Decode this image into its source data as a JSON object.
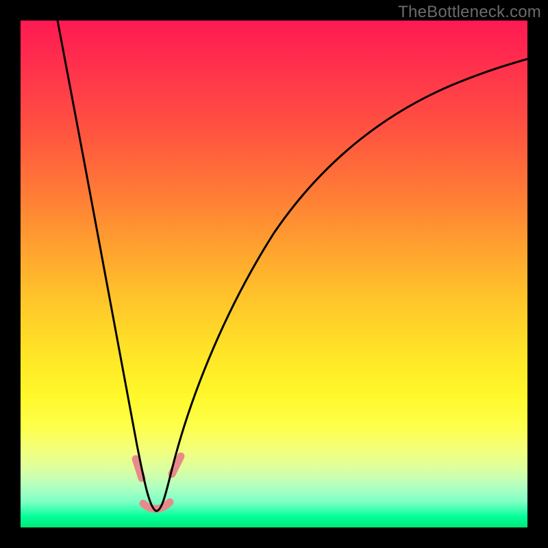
{
  "watermark": "TheBottleneck.com",
  "chart_data": {
    "type": "line",
    "title": "",
    "xlabel": "",
    "ylabel": "",
    "xlim": [
      0,
      100
    ],
    "ylim": [
      0,
      100
    ],
    "grid": false,
    "legend": false,
    "series": [
      {
        "name": "bottleneck-curve",
        "x": [
          7,
          11,
          15,
          18,
          20,
          22,
          24,
          25,
          26,
          27,
          28,
          29,
          30,
          33,
          37,
          42,
          48,
          55,
          63,
          72,
          82,
          92,
          100
        ],
        "y": [
          100,
          80,
          60,
          42,
          30,
          18,
          8,
          3,
          2.5,
          2.5,
          3,
          4,
          6,
          14,
          25,
          37,
          49,
          60,
          69,
          77,
          82,
          86,
          88
        ]
      }
    ],
    "markers": [
      {
        "name": "left-segment-upper",
        "x_range": [
          22.5,
          24.0
        ],
        "approx_y": [
          12,
          6
        ]
      },
      {
        "name": "right-segment-upper",
        "x_range": [
          29.5,
          31.5
        ],
        "approx_y": [
          6,
          10
        ]
      },
      {
        "name": "valley-segment",
        "x_range": [
          24.5,
          29.0
        ],
        "approx_y": [
          3,
          3
        ]
      }
    ],
    "gradient_stops": [
      {
        "pos": 0,
        "color": "#ff1a52"
      },
      {
        "pos": 22,
        "color": "#ff5440"
      },
      {
        "pos": 45,
        "color": "#ffa22f"
      },
      {
        "pos": 65,
        "color": "#ffe327"
      },
      {
        "pos": 85,
        "color": "#f2ff7e"
      },
      {
        "pos": 100,
        "color": "#00e676"
      }
    ]
  }
}
